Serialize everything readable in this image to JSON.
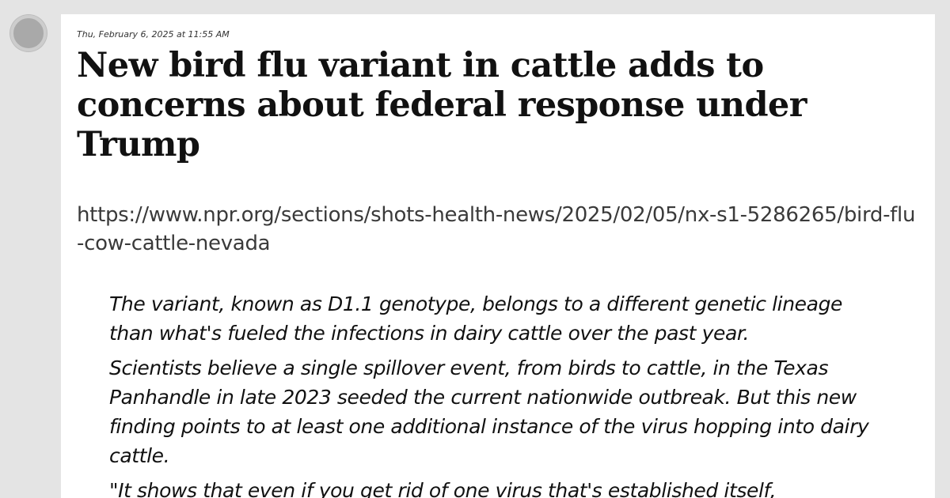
{
  "post": {
    "timestamp": "Thu, February 6, 2025 at 11:55 AM",
    "headline": "New bird flu variant in cattle adds to concerns about federal response under Trump",
    "url": "https://www.npr.org/sections/shots-health-news/2025/02/05/nx-s1-5286265/bird-flu-cow-cattle-nevada",
    "quote_paragraphs": [
      "The variant, known as D1.1 genotype, belongs to a different genetic lineage than what's fueled the infections in dairy cattle over the past year.",
      "Scientists believe a single spillover event, from birds to cattle, in the Texas Panhandle in late 2023 seeded the current nationwide outbreak. But this new finding points to at least one additional instance of the virus hopping into dairy cattle.",
      "\"It shows that even if you get rid of one virus that's established itself,"
    ]
  },
  "icons": {
    "avatar": "avatar-circle"
  },
  "colors": {
    "background": "#e4e4e4",
    "card": "#ffffff",
    "avatar": "#a9a9a9"
  }
}
